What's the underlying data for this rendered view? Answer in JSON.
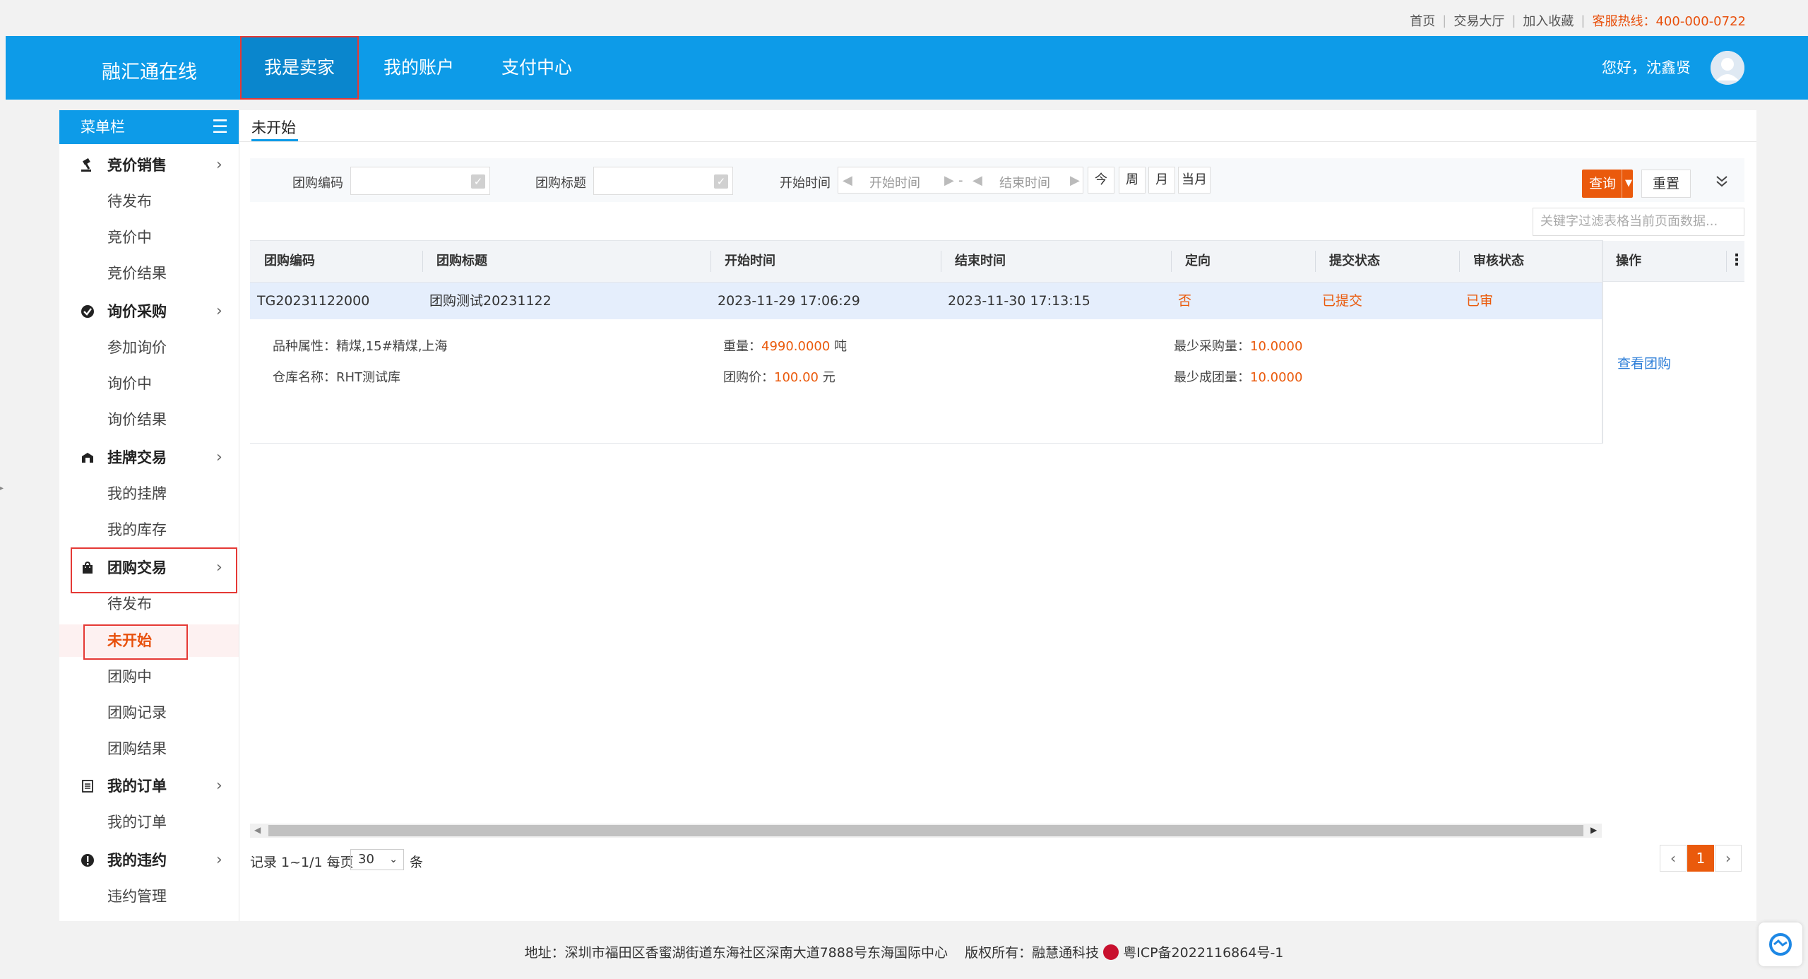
{
  "topbar": {
    "links": [
      "首页",
      "交易大厅",
      "加入收藏"
    ],
    "hotline": "客服热线：400-000-0722"
  },
  "header": {
    "brand": "融汇通在线",
    "nav": [
      "我是卖家",
      "我的账户",
      "支付中心"
    ],
    "greeting": "您好，沈鑫贤"
  },
  "sidebar": {
    "title": "菜单栏",
    "groups": [
      {
        "label": "竞价销售",
        "items": [
          "待发布",
          "竞价中",
          "竞价结果"
        ]
      },
      {
        "label": "询价采购",
        "items": [
          "参加询价",
          "询价中",
          "询价结果"
        ]
      },
      {
        "label": "挂牌交易",
        "items": [
          "我的挂牌",
          "我的库存"
        ]
      },
      {
        "label": "团购交易",
        "items": [
          "待发布",
          "未开始",
          "团购中",
          "团购记录",
          "团购结果"
        ]
      },
      {
        "label": "我的订单",
        "items": [
          "我的订单"
        ]
      },
      {
        "label": "我的违约",
        "items": [
          "违约管理"
        ]
      }
    ],
    "active_item": "未开始"
  },
  "tab": {
    "label": "未开始"
  },
  "filters": {
    "code_label": "团购编码",
    "title_label": "团购标题",
    "time_label": "开始时间",
    "start_placeholder": "开始时间",
    "dash": "-",
    "end_placeholder": "结束时间",
    "quick": [
      "今",
      "周",
      "月",
      "当月"
    ],
    "query_label": "查询",
    "reset_label": "重置",
    "keyword_placeholder": "关键字过滤表格当前页面数据..."
  },
  "table": {
    "columns": [
      "团购编码",
      "团购标题",
      "开始时间",
      "结束时间",
      "定向",
      "提交状态",
      "审核状态",
      "操作"
    ],
    "rows": [
      {
        "code": "TG20231122000",
        "title": "团购测试20231122",
        "start": "2023-11-29 17:06:29",
        "end": "2023-11-30 17:13:15",
        "directed": "否",
        "submit_status": "已提交",
        "audit_status": "已审",
        "detail": {
          "variety_label": "品种属性：",
          "variety": "精煤,15#精煤,上海",
          "warehouse_label": "仓库名称：",
          "warehouse": "RHT测试库",
          "weight_label": "重量：",
          "weight": "4990.0000",
          "weight_unit": "吨",
          "price_label": "团购价：",
          "price": "100.00",
          "price_unit": "元",
          "min_purchase_label": "最少采购量：",
          "min_purchase": "10.0000",
          "min_group_label": "最少成团量：",
          "min_group": "10.0000"
        },
        "action": "查看团购"
      }
    ]
  },
  "pagination": {
    "records_prefix": "记录 1~1/1 每页",
    "per_page": "30",
    "suffix": "条",
    "current": "1"
  },
  "footer": {
    "address": "地址：深圳市福田区香蜜湖街道东海社区深南大道7888号东海国际中心",
    "copyright": "版权所有：融慧通科技",
    "icp": "粤ICP备2022116864号-1"
  },
  "colors": {
    "brand_blue": "#0d9be8",
    "accent_orange": "#ea5a0c",
    "link_blue": "#2f7fd8",
    "highlight_red": "#e53935"
  }
}
